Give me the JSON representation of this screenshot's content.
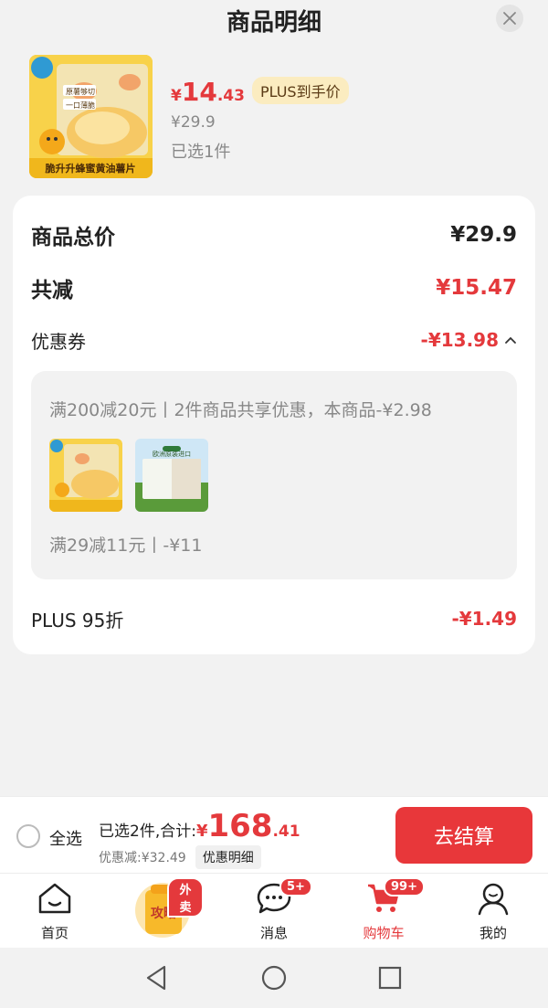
{
  "header": {
    "title": "商品明细"
  },
  "product": {
    "image_caption": "脆升升蜂蜜黄油薯片",
    "image_tags": [
      "原薯够切",
      "一口薄脆"
    ],
    "currency": "¥",
    "price_int": "14",
    "price_dec": ".43",
    "plus_tag": "PLUS到手价",
    "original_price": "¥29.9",
    "selected": "已选1件"
  },
  "summary": {
    "total_label": "商品总价",
    "total_value": "¥29.9",
    "discount_label": "共减",
    "discount_value": "¥15.47",
    "coupon_label": "优惠券",
    "coupon_value": "-¥13.98",
    "coupon_line1": "满200减20元丨2件商品共享优惠，本商品-¥2.98",
    "thumb2_caption": "欧洲原装进口",
    "coupon_line2": "满29减11元丨-¥11",
    "plus_label": "PLUS 95折",
    "plus_value": "-¥1.49"
  },
  "checkout": {
    "select_all": "全选",
    "selected_total_label": "已选2件,合计:",
    "currency": "¥",
    "total_int": "168",
    "total_dec": ".41",
    "saved": "优惠减:¥32.49",
    "detail_button": "优惠明细",
    "pay_button": "去结算"
  },
  "tabbar": {
    "items": [
      {
        "label": "首页",
        "icon": "home-icon"
      },
      {
        "label": "攻略",
        "icon": "promo-bag-icon",
        "badge": "外卖"
      },
      {
        "label": "消息",
        "icon": "message-icon",
        "badge": "5+"
      },
      {
        "label": "购物车",
        "icon": "cart-icon",
        "badge": "99+"
      },
      {
        "label": "我的",
        "icon": "user-icon"
      }
    ]
  },
  "colors": {
    "accent": "#e4393c",
    "plus_tag_bg": "#fbecc0",
    "background": "#f2f2f2"
  }
}
